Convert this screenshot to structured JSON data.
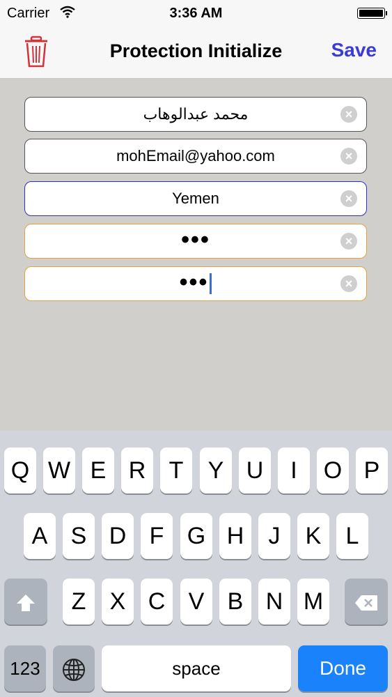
{
  "status_bar": {
    "carrier": "Carrier",
    "time": "3:36 AM"
  },
  "navbar": {
    "title": "Protection Initialize",
    "save_label": "Save"
  },
  "form": {
    "name_value": "محمد عبدالوهاب",
    "email_value": "mohEmail@yahoo.com",
    "country_value": "Yemen",
    "password_value": "•••",
    "confirm_password_value": "•••"
  },
  "keyboard": {
    "row1": [
      "Q",
      "W",
      "E",
      "R",
      "T",
      "Y",
      "U",
      "I",
      "O",
      "P"
    ],
    "row2": [
      "A",
      "S",
      "D",
      "F",
      "G",
      "H",
      "J",
      "K",
      "L"
    ],
    "row3": [
      "Z",
      "X",
      "C",
      "V",
      "B",
      "N",
      "M"
    ],
    "numbers_label": "123",
    "space_label": "space",
    "done_label": "Done"
  },
  "colors": {
    "accent": "#3b3bd6",
    "done_key": "#1a82fb",
    "trash": "#d0343a",
    "warn_border": "#e6a23c"
  }
}
